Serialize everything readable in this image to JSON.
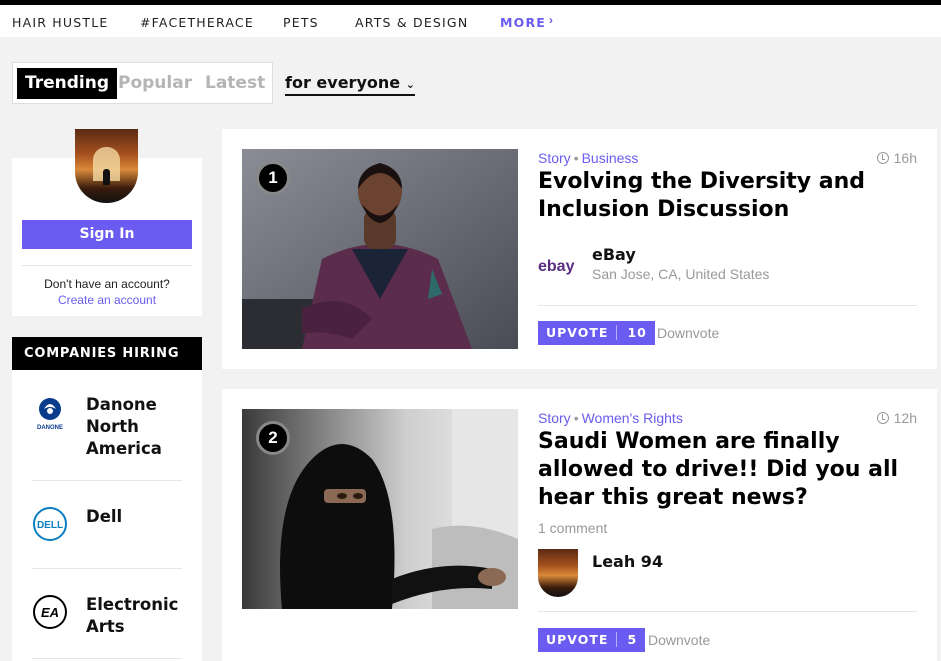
{
  "nav": {
    "items": [
      "HAIR HUSTLE",
      "#FACETHERACE",
      "PETS",
      "ARTS & DESIGN"
    ],
    "more_label": "MORE",
    "more_icon": "chevron-right-icon"
  },
  "feed_tabs": {
    "tabs": [
      "Trending",
      "Popular",
      "Latest"
    ],
    "active": "Trending",
    "audience_select": "for everyone"
  },
  "account": {
    "signin_label": "Sign In",
    "no_account_text": "Don't have an account?",
    "create_label": "Create an account"
  },
  "hiring": {
    "heading": "COMPANIES HIRING",
    "companies": [
      {
        "name": "Danone North America",
        "logo_text": "DANONE",
        "logo_color": "#0a3c8c"
      },
      {
        "name": "Dell",
        "logo_text": "DELL",
        "logo_color": "#0a7fc2"
      },
      {
        "name": "Electronic Arts",
        "logo_text": "EA",
        "logo_color": "#000000"
      }
    ]
  },
  "posts": [
    {
      "rank": "1",
      "type": "Story",
      "category": "Business",
      "time": "16h",
      "title": "Evolving the Diversity and Inclusion Discussion",
      "author": "eBay",
      "location": "San Jose, CA, United States",
      "upvote_label": "UPVOTE",
      "upvotes": "10",
      "downvote_label": "Downvote"
    },
    {
      "rank": "2",
      "type": "Story",
      "category": "Women's Rights",
      "time": "12h",
      "title": "Saudi Women are finally allowed to drive!! Did you all hear this great news?",
      "comments": "1 comment",
      "author": "Leah 94",
      "upvote_label": "UPVOTE",
      "upvotes": "5",
      "downvote_label": "Downvote"
    }
  ],
  "colors": {
    "accent": "#6a5cf0",
    "muted": "#999999"
  }
}
